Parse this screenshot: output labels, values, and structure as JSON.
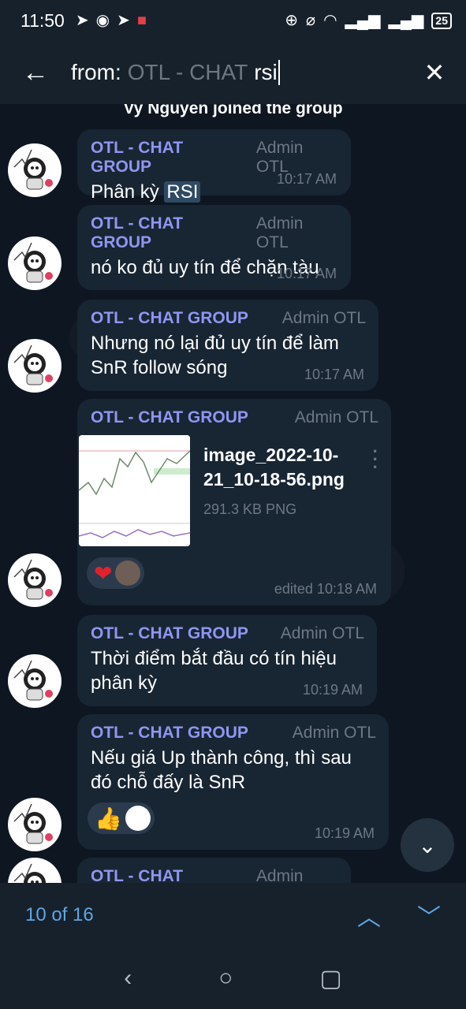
{
  "status_bar": {
    "time": "11:50",
    "left_icons": [
      "telegram-icon",
      "messenger-icon",
      "telegram-icon",
      "shield-app-icon"
    ],
    "right_icons": [
      "data-saver-icon",
      "mute-icon",
      "wifi-icon",
      "signal-icon",
      "signal-icon"
    ],
    "battery": "25"
  },
  "search_header": {
    "prefix": "from:",
    "chat_name": "OTL - CHAT",
    "query": "rsi"
  },
  "service_message": "Vy Nguyen joined the group",
  "messages": [
    {
      "sender": "OTL - CHAT GROUP",
      "role": "Admin OTL",
      "text_before": "Phân kỳ ",
      "highlight": "RSI",
      "time": "10:17 AM"
    },
    {
      "sender": "OTL - CHAT GROUP",
      "role": "Admin OTL",
      "text": "nó ko đủ uy tín để chặn tàu",
      "time": "10:17 AM"
    },
    {
      "sender": "OTL - CHAT GROUP",
      "role": "Admin OTL",
      "text": "Nhưng nó lại đủ uy tín để làm SnR follow sóng",
      "time": "10:17 AM"
    },
    {
      "sender": "OTL - CHAT GROUP",
      "role": "Admin OTL",
      "file_name": "image_2022-10-21_10-18-56.png",
      "file_size": "291.3 KB PNG",
      "reaction": "❤",
      "time": "edited 10:18 AM"
    },
    {
      "sender": "OTL - CHAT GROUP",
      "role": "Admin OTL",
      "text": "Thời điểm bắt đầu có tín hiệu phân kỳ",
      "time": "10:19 AM"
    },
    {
      "sender": "OTL - CHAT GROUP",
      "role": "Admin OTL",
      "text": "Nếu giá Up thành công, thì sau đó chỗ đấy là SnR",
      "reaction": "👍",
      "time": "10:19 AM"
    },
    {
      "sender": "OTL - CHAT GROUP",
      "role": "Admin OTL"
    }
  ],
  "search_nav": {
    "counter": "10 of 16"
  },
  "colors": {
    "background": "#0e1621",
    "bubble": "#182533",
    "sender": "#8f96f0",
    "accent": "#5ea6e4"
  }
}
